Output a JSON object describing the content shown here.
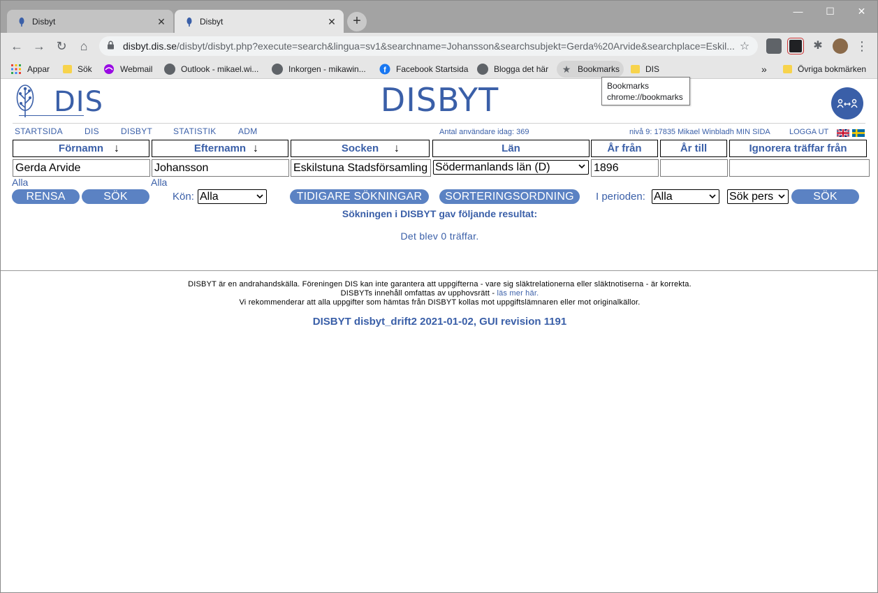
{
  "browser": {
    "tabs": [
      {
        "title": "Disbyt",
        "close": "✕"
      },
      {
        "title": "Disbyt",
        "close": "✕"
      }
    ],
    "new_tab": "+",
    "window_controls": {
      "minimize": "—",
      "maximize": "☐",
      "close": "✕"
    },
    "nav": {
      "back": "←",
      "forward": "→",
      "reload": "↻",
      "home": "⌂"
    },
    "url_host": "disbyt.dis.se",
    "url_path": "/disbyt/disbyt.php?execute=search&lingua=sv1&searchname=Johansson&searchsubjekt=Gerda%20Arvide&searchplace=Eskil...",
    "star": "☆",
    "bookmarks": [
      {
        "label": "Appar",
        "icon": "apps-grid-icon"
      },
      {
        "label": "Sök",
        "icon": "folder-icon"
      },
      {
        "label": "Webmail",
        "icon": "telia-icon"
      },
      {
        "label": "Outlook - mikael.wi...",
        "icon": "globe-icon"
      },
      {
        "label": "Inkorgen - mikawin...",
        "icon": "globe-icon"
      },
      {
        "label": "Facebook Startsida",
        "icon": "facebook-icon"
      },
      {
        "label": "Blogga det här",
        "icon": "globe-icon"
      },
      {
        "label": "Bookmarks",
        "icon": "star-icon"
      },
      {
        "label": "DIS",
        "icon": "folder-icon"
      }
    ],
    "bookmarks_more": "»",
    "other_bookmarks": "Övriga bokmärken",
    "tooltip": {
      "line1": "Bookmarks",
      "line2": "chrome://bookmarks"
    }
  },
  "site": {
    "logo_text": "DIS",
    "title": "DISBYT",
    "menu": [
      "STARTSIDA",
      "DIS",
      "DISBYT",
      "STATISTIK",
      "ADM"
    ],
    "users_today": "Antal användare idag: 369",
    "user_line": "nivå 9: 17835 Mikael Winbladh MIN SIDA",
    "logout": "LOGGA UT"
  },
  "search": {
    "headers": [
      "Förnamn",
      "Efternamn",
      "Socken",
      "Län",
      "År från",
      "År till",
      "Ignorera träffar från"
    ],
    "sort_arrow": "↓",
    "values": {
      "fornamn": "Gerda Arvide",
      "efternamn": "Johansson",
      "socken": "Eskilstuna Stadsförsamling",
      "lan": "Södermanlands län (D)",
      "ar_fran": "1896",
      "ar_till": "",
      "ignorera": ""
    },
    "alla_link_1": "Alla",
    "alla_link_2": "Alla",
    "buttons": {
      "rensa": "RENSA",
      "sok1": "SÖK",
      "tidigare": "TIDIGARE SÖKNINGAR",
      "sortering": "SORTERINGSORDNING",
      "sok2": "SÖK"
    },
    "kon_label": "Kön:",
    "kon_value": "Alla",
    "perioden_label": "I perioden:",
    "perioden_value": "Alla",
    "sok_pers_value": "Sök pers"
  },
  "results": {
    "heading": "Sökningen i DISBYT gav följande resultat:",
    "count": "Det blev 0 träffar."
  },
  "footer": {
    "line1": "DISBYT är en andrahandskälla. Föreningen DIS kan inte garantera att uppgifterna - vare sig släktrelationerna eller släktnotiserna - är korrekta.",
    "line2_prefix": "DISBYTs innehåll omfattas av upphovsrätt - ",
    "line2_link": "läs mer här.",
    "line3": "Vi rekommenderar att alla uppgifter som hämtas från DISBYT kollas mot uppgiftslämnaren eller mot originalkällor.",
    "version": "DISBYT disbyt_drift2 2021-01-02, GUI revision 1191"
  },
  "colors": {
    "brand_blue": "#3a5fa8",
    "button_blue": "#5b82c3",
    "browser_frame": "#a3a3a3"
  }
}
